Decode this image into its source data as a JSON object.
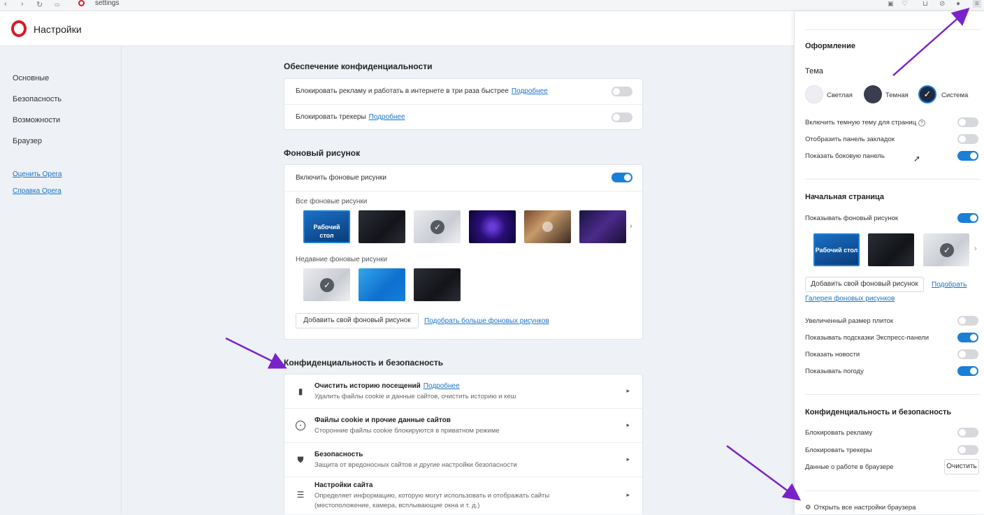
{
  "tab": {
    "title": "settings"
  },
  "header": {
    "title": "Настройки"
  },
  "sidebar": {
    "items": [
      {
        "label": "Основные"
      },
      {
        "label": "Безопасность"
      },
      {
        "label": "Возможности"
      },
      {
        "label": "Браузер"
      }
    ],
    "links": [
      {
        "label": "Оценить Opera"
      },
      {
        "label": "Справка Opera"
      }
    ]
  },
  "privacy": {
    "title": "Обеспечение конфиденциальности",
    "rows": [
      {
        "text": "Блокировать рекламу и работать в интернете в три раза быстрее",
        "link": "Подробнее",
        "on": false
      },
      {
        "text": "Блокировать трекеры",
        "link": "Подробнее",
        "on": false
      }
    ]
  },
  "wallpaper": {
    "title": "Фоновый рисунок",
    "enable_label": "Включить фоновые рисунки",
    "enable_on": true,
    "all_label": "Все фоновые рисунки",
    "recent_label": "Недавние фоновые рисунки",
    "desktop_thumb_label": "Рабочий стол",
    "add_button": "Добавить свой фоновый рисунок",
    "more_link": "Подобрать больше фоновых рисунков"
  },
  "security": {
    "title": "Конфиденциальность и безопасность",
    "items": [
      {
        "icon": "trash-icon",
        "title": "Очистить историю посещений",
        "link": "Подробнее",
        "subtitle": "Удалить файлы cookie и данные сайтов, очистить историю и кеш"
      },
      {
        "icon": "cookie-icon",
        "title": "Файлы cookie и прочие данные сайтов",
        "link": "",
        "subtitle": "Сторонние файлы cookie блокируются в приватном режиме"
      },
      {
        "icon": "shield-icon",
        "title": "Безопасность",
        "link": "",
        "subtitle": "Защита от вредоносных сайтов и другие настройки безопасности"
      },
      {
        "icon": "sliders-icon",
        "title": "Настройки сайта",
        "link": "",
        "subtitle": "Определяет информацию, которую могут использовать и отображать сайты",
        "subtitle2": "(местоположение, камера, всплывающие окна и т. д.)"
      }
    ]
  },
  "panel": {
    "appearance_title": "Оформление",
    "theme_label": "Тема",
    "themes": [
      {
        "label": "Светлая",
        "color": "#eceef1"
      },
      {
        "label": "Темная",
        "color": "#3a3d50"
      },
      {
        "label": "Система",
        "color": "#1f2a3c"
      }
    ],
    "appearance_toggles": [
      {
        "label": "Включить темную тему для страниц",
        "on": false
      },
      {
        "label": "Отобразить панель закладок",
        "on": false
      },
      {
        "label": "Показать боковую панель",
        "on": true
      }
    ],
    "start_title": "Начальная страница",
    "start_wallpaper_label": "Показывать фоновый рисунок",
    "start_wallpaper_on": true,
    "desktop_thumb_label": "Рабочий стол",
    "add_button": "Добавить свой фоновый рисунок",
    "more_link": "Подобрать",
    "gallery_link": "Галерея фоновых рисунков",
    "start_toggles": [
      {
        "label": "Увеличенный размер плиток",
        "on": false
      },
      {
        "label": "Показывать подсказки Экспресс-панели",
        "on": true
      },
      {
        "label": "Показать новости",
        "on": false
      },
      {
        "label": "Показывать погоду",
        "on": true
      }
    ],
    "privacy_title": "Конфиденциальность и безопасность",
    "privacy_toggles": [
      {
        "label": "Блокировать рекламу",
        "on": false
      },
      {
        "label": "Блокировать трекеры",
        "on": false
      }
    ],
    "browser_data_label": "Данные о работе в браузере",
    "clear_button": "Очистить",
    "all_settings_link": "Открыть все настройки браузера"
  },
  "colors": {
    "accent": "#1a7fd6",
    "brand": "#d81b28",
    "arrow": "#7a22c9"
  }
}
